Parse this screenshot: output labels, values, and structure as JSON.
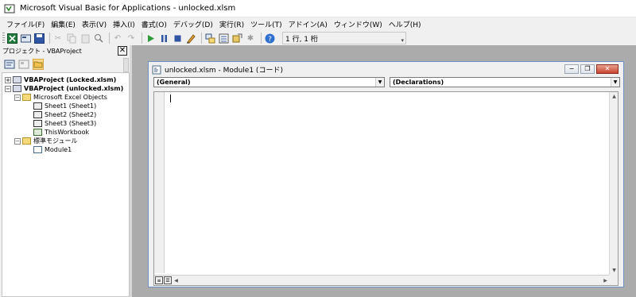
{
  "window": {
    "title": "Microsoft Visual Basic for Applications - unlocked.xlsm"
  },
  "menu": [
    "ファイル(F)",
    "編集(E)",
    "表示(V)",
    "挿入(I)",
    "書式(O)",
    "デバッグ(D)",
    "実行(R)",
    "ツール(T)",
    "アドイン(A)",
    "ウィンドウ(W)",
    "ヘルプ(H)"
  ],
  "toolbar": {
    "position": "1 行, 1 桁"
  },
  "project": {
    "title": "プロジェクト - VBAProject",
    "close": "✕",
    "tree": [
      {
        "label": "VBAProject (Locked.xlsm)",
        "expander": "+"
      },
      {
        "label": "VBAProject (unlocked.xlsm)",
        "expander": "−"
      },
      {
        "label": "Microsoft Excel Objects",
        "expander": "−"
      },
      {
        "label": "Sheet1 (Sheet1)"
      },
      {
        "label": "Sheet2 (Sheet2)"
      },
      {
        "label": "Sheet3 (Sheet3)"
      },
      {
        "label": "ThisWorkbook"
      },
      {
        "label": "標準モジュール",
        "expander": "−"
      },
      {
        "label": "Module1"
      }
    ]
  },
  "code_window": {
    "title": "unlocked.xlsm - Module1 (コード)",
    "object_combo": "(General)",
    "procedure_combo": "(Declarations)",
    "minimize": "−",
    "restore": "❐",
    "close": "✕"
  },
  "colors": {
    "workspace": "#ababab",
    "window_border": "#6d8fc4",
    "close_button": "#c8452f"
  }
}
